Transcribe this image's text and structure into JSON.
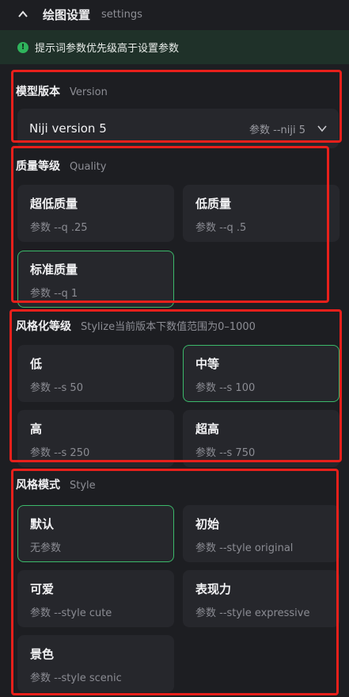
{
  "header": {
    "title": "绘图设置",
    "subtitle": "settings",
    "icon": "chevron-up-icon"
  },
  "notice": {
    "icon": "exclamation-circle-icon",
    "text": "提示词参数优先级高于设置参数"
  },
  "version": {
    "title": "模型版本",
    "subtitle": "Version",
    "selected": "Niji version 5",
    "param": "参数 --niji 5",
    "icon": "chevron-down-icon"
  },
  "quality": {
    "title": "质量等级",
    "subtitle": "Quality",
    "options": [
      {
        "label": "超低质量",
        "param": "参数 --q .25"
      },
      {
        "label": "低质量",
        "param": "参数 --q .5"
      },
      {
        "label": "标准质量",
        "param": "参数 --q 1",
        "selected": true
      }
    ]
  },
  "stylize": {
    "title": "风格化等级",
    "subtitle": "Stylize当前版本下数值范围为0–1000",
    "options": [
      {
        "label": "低",
        "param": "参数 --s 50"
      },
      {
        "label": "中等",
        "param": "参数 --s 100",
        "selected": true
      },
      {
        "label": "高",
        "param": "参数 --s 250"
      },
      {
        "label": "超高",
        "param": "参数 --s 750"
      }
    ]
  },
  "style": {
    "title": "风格模式",
    "subtitle": "Style",
    "options": [
      {
        "label": "默认",
        "param": "无参数",
        "selected": true
      },
      {
        "label": "初始",
        "param": "参数 --style original"
      },
      {
        "label": "可爱",
        "param": "参数 --style cute"
      },
      {
        "label": "表现力",
        "param": "参数 --style expressive"
      },
      {
        "label": "景色",
        "param": "参数 --style scenic"
      }
    ]
  },
  "colors": {
    "accent": "#3bb96a",
    "highlight_box": "#e8201b",
    "notice_bg": "#1f3129",
    "card_bg": "#26272c"
  }
}
